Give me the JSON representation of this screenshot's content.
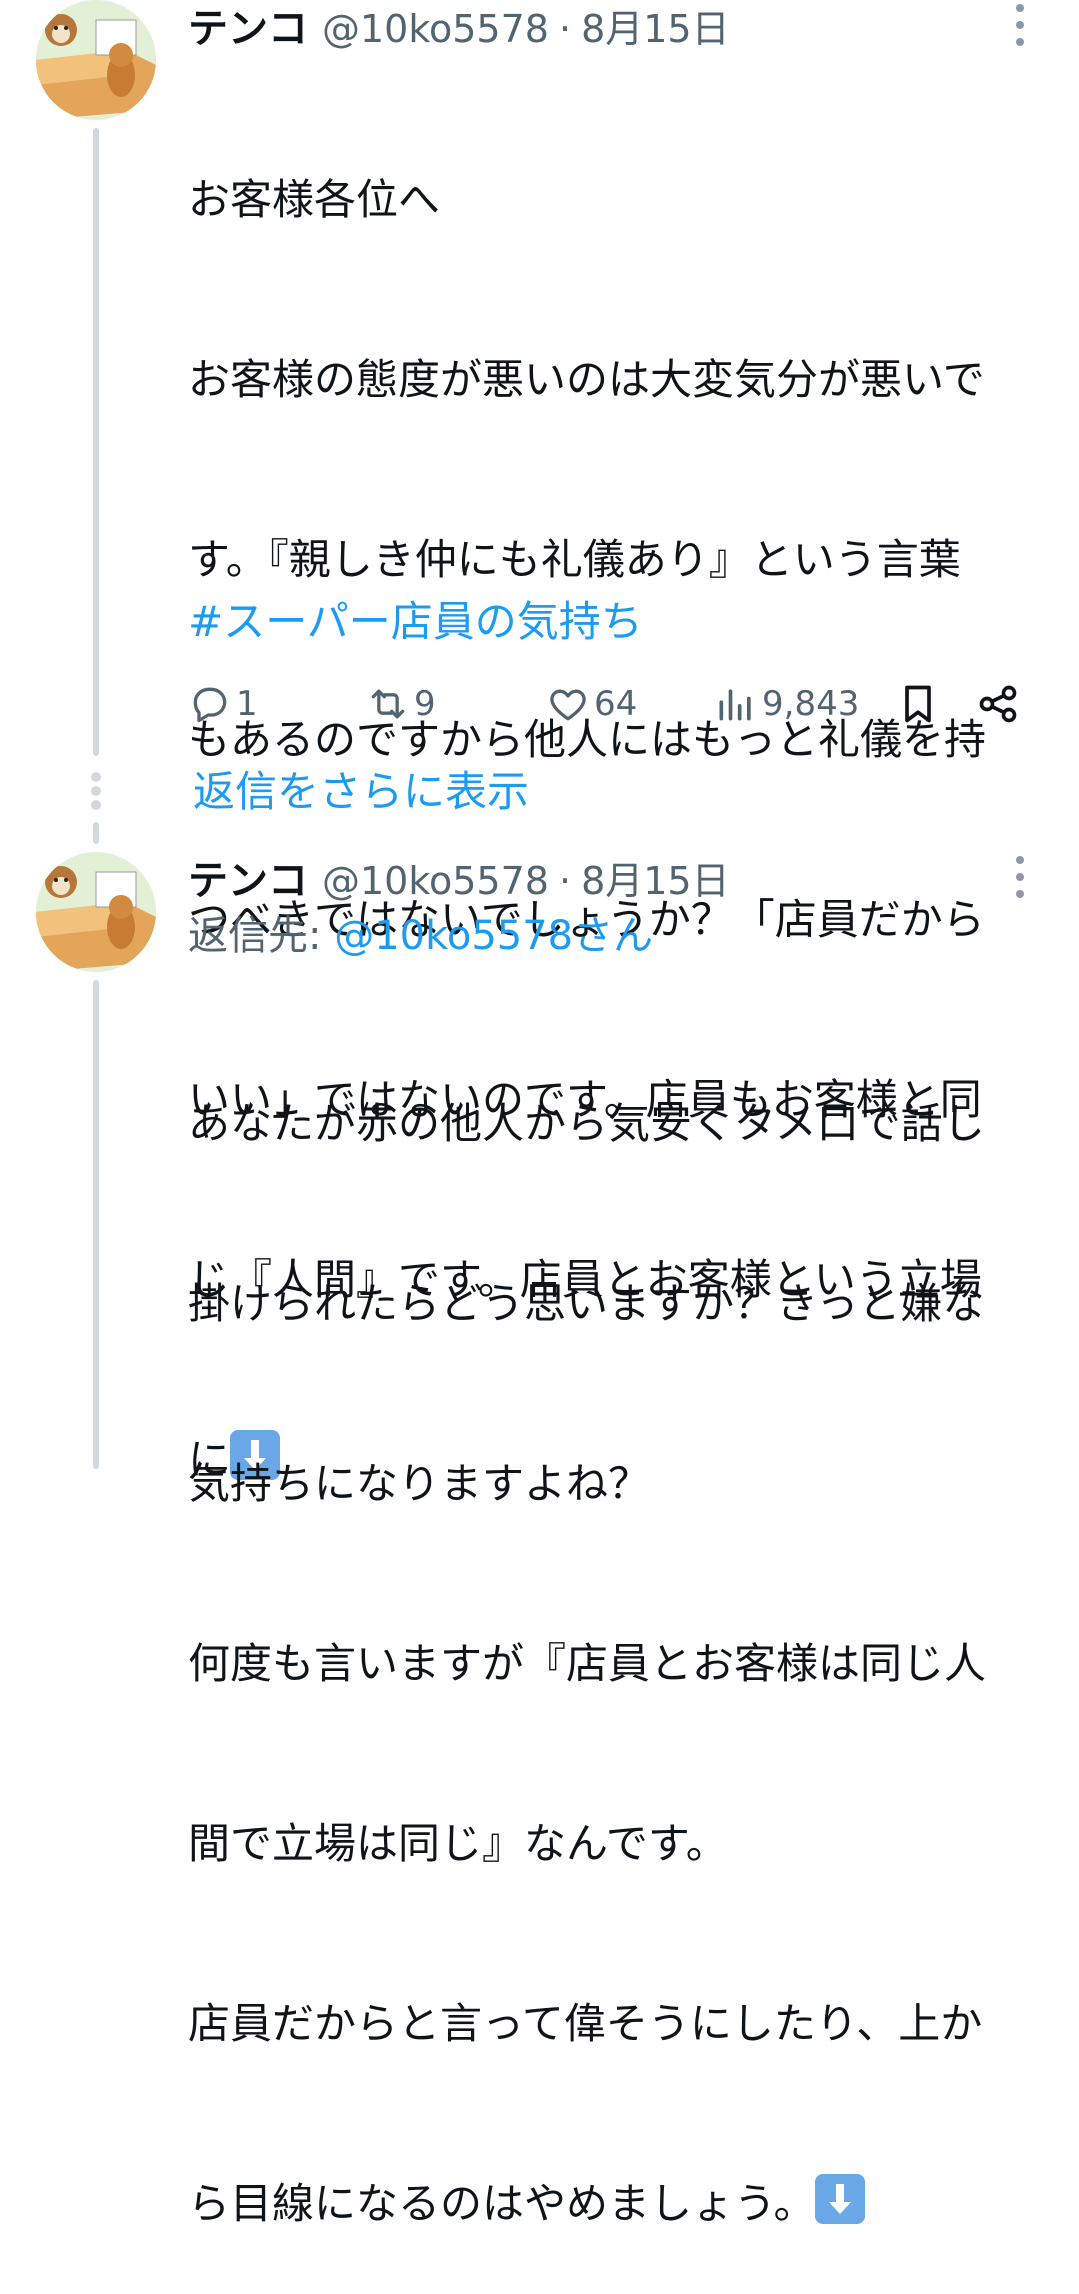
{
  "tweets": [
    {
      "name": "テンコ",
      "handle": "@10ko5578",
      "separator": "·",
      "date": "8月15日",
      "text_lines": [
        "お客様各位へ",
        "お客様の態度が悪いのは大変気分が悪いで",
        "す。『親しき仲にも礼儀あり』という言葉",
        "もあるのですから他人にはもっと礼儀を持",
        "つべきではないでしょうか？「店員だから",
        "いい」ではないのです。店員もお客様と同",
        "じ『人間』です。店員とお客様という立場",
        "に"
      ],
      "emoji": "down-arrow-emoji",
      "hashtag": "#スーパー店員の気持ち",
      "actions": {
        "reply_count": "1",
        "retweet_count": "9",
        "like_count": "64",
        "views_count": "9,843"
      }
    },
    {
      "name": "テンコ",
      "handle": "@10ko5578",
      "separator": "·",
      "date": "8月15日",
      "replying_label": "返信先: ",
      "replying_to": "@10ko5578さん",
      "text_lines": [
        "あなたが赤の他人から気安くタメ口で話し",
        "掛けられたらどう思いますか？きっと嫌な",
        "気持ちになりますよね？",
        "何度も言いますが『店員とお客様は同じ人",
        "間で立場は同じ』なんです。",
        "店員だからと言って偉そうにしたり、上か",
        "ら目線になるのはやめましょう。"
      ],
      "emoji": "down-arrow-emoji"
    }
  ],
  "show_more_replies": "返信をさらに表示",
  "colors": {
    "link": "#1d9bf0",
    "muted": "#536471",
    "text": "#0f1419",
    "thread_line": "#cfd9de"
  }
}
